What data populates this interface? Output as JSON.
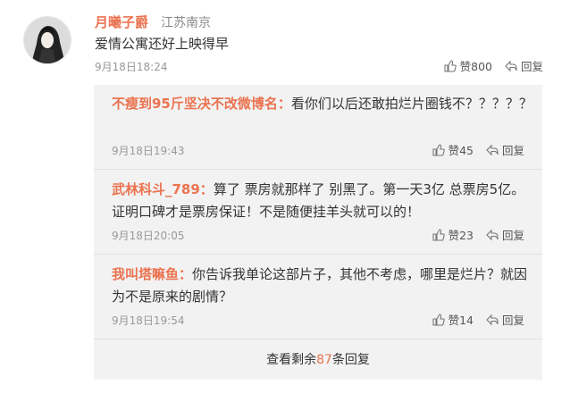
{
  "post": {
    "user_name": "月曦子爵",
    "location": "江苏南京",
    "text": "爱情公寓还好上映得早",
    "time": "9月18日18:24",
    "like_label": "赞800",
    "reply_label": "回复"
  },
  "replies": [
    {
      "name": "不瘦到95斤坚决不改微博名：",
      "text": "看你们以后还敢拍烂片圈钱不？？？？？",
      "time": "9月18日19:43",
      "like_label": "赞45",
      "reply_label": "回复"
    },
    {
      "name": "武林科斗_789：",
      "text": "算了 票房就那样了 别黑了。第一天3亿 总票房5亿。证明口碑才是票房保证！不是随便挂羊头就可以的！",
      "time": "9月18日20:05",
      "like_label": "赞23",
      "reply_label": "回复"
    },
    {
      "name": "我叫塔嘛鱼：",
      "text": "你告诉我单论这部片子，其他不考虑，哪里是烂片？就因为不是原来的剧情？",
      "time": "9月18日19:54",
      "like_label": "赞14",
      "reply_label": "回复"
    }
  ],
  "more": {
    "prefix": "查看剩余",
    "count": "87",
    "suffix": "条回复"
  },
  "colors": {
    "accent": "#eb7350",
    "panel": "#f2f2f2"
  }
}
